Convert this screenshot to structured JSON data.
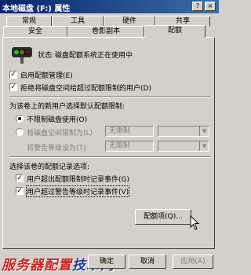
{
  "window": {
    "title": "本地磁盘 (F:) 属性",
    "help_button": "?",
    "close_button": "×"
  },
  "tabs_row1": [
    "常规",
    "工具",
    "硬件",
    "共享"
  ],
  "tabs_row2": [
    "安全",
    "卷影副本",
    "配额"
  ],
  "status": {
    "label": "状态:",
    "text": "磁盘配额系统正在使用中"
  },
  "options": {
    "enable_quota": {
      "label": "启用配额管理(E)",
      "checked": true
    },
    "deny_space": {
      "label": "拒绝将磁盘空间给超过配额限制的用户(D)",
      "checked": true
    }
  },
  "default_limit": {
    "heading": "为该卷上的新用户选择默认配额限制:",
    "no_limit": {
      "label": "不限制磁盘使用(O)",
      "selected": true
    },
    "limit_to": {
      "label": "将磁盘空间限制为(L)",
      "selected": false,
      "value": "无限制"
    },
    "warning": {
      "label": "将警告等级设为(T)",
      "value": "无限制"
    }
  },
  "logging": {
    "heading": "选择该卷的配额记录选项:",
    "log_limit": {
      "label": "用户超出配额限制时记录事件(G)",
      "checked": true
    },
    "log_warning": {
      "label": "用户超过警告等级时记录事件(V)",
      "checked": true
    }
  },
  "quota_entries_button": "配额项(Q)...",
  "buttons": {
    "ok": "确定",
    "cancel": "取消",
    "apply": "应用(A)"
  },
  "watermark": {
    "part1": "服务器配置",
    "part2": "技术网"
  }
}
